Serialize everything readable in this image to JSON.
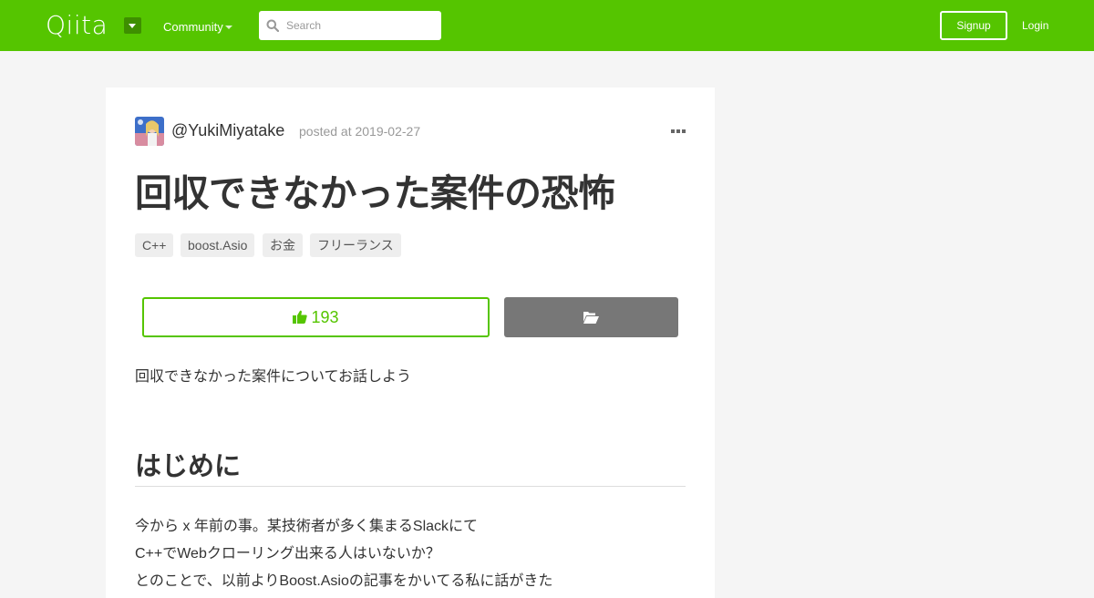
{
  "header": {
    "logo_text": "Qiita",
    "community_label": "Community",
    "search": {
      "placeholder": "Search",
      "value": ""
    },
    "signup_label": "Signup",
    "login_label": "Login",
    "brand_color": "#55c500"
  },
  "article": {
    "author": "@YukiMiyatake",
    "posted": "posted at 2019-02-27",
    "title": "回収できなかった案件の恐怖",
    "tags": [
      "C++",
      "boost.Asio",
      "お金",
      "フリーランス"
    ],
    "like_count": "193",
    "lead": "回収できなかった案件についてお話しよう",
    "section_heading": "はじめに",
    "paragraphs": [
      "今から x 年前の事。某技術者が多く集まるSlackにて",
      "C++でWebクローリング出来る人はいないか？",
      "とのことで、以前よりBoost.Asioの記事をかいてる私に話がきた"
    ]
  },
  "icons": {
    "search": "search-icon",
    "more": "more-horizontal-icon",
    "like": "thumbs-up-icon",
    "stock": "folder-open-icon",
    "dropdown": "caret-down-icon"
  }
}
